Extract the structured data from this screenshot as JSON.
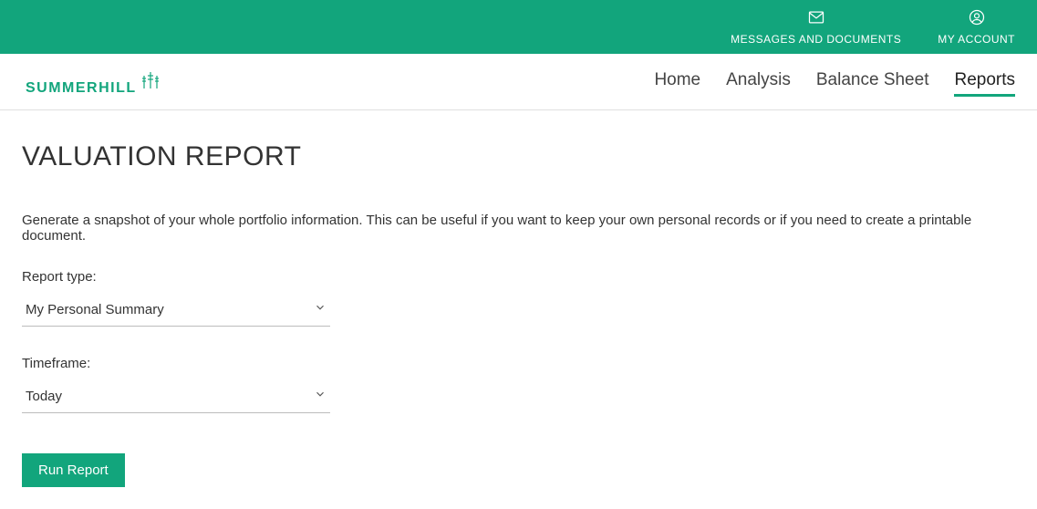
{
  "topbar": {
    "messages_label": "MESSAGES AND DOCUMENTS",
    "account_label": "MY ACCOUNT"
  },
  "logo": {
    "text": "SUMMERHILL"
  },
  "nav": {
    "items": [
      {
        "label": "Home",
        "active": false
      },
      {
        "label": "Analysis",
        "active": false
      },
      {
        "label": "Balance Sheet",
        "active": false
      },
      {
        "label": "Reports",
        "active": true
      }
    ]
  },
  "page": {
    "title": "VALUATION REPORT",
    "description": "Generate a snapshot of your whole portfolio information. This can be useful if you want to keep your own personal records or if you need to create a printable document."
  },
  "form": {
    "report_type_label": "Report type:",
    "report_type_value": "My Personal Summary",
    "timeframe_label": "Timeframe:",
    "timeframe_value": "Today",
    "run_button": "Run Report"
  }
}
